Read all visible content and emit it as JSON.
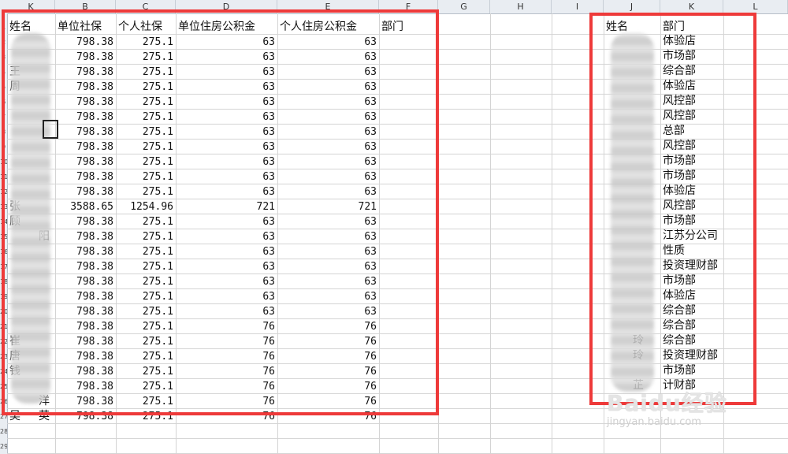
{
  "column_headers": [
    "K",
    "B",
    "C",
    "D",
    "E",
    "F",
    "G",
    "H",
    "I",
    "J",
    "K",
    "L"
  ],
  "row_numbers": [
    "1",
    "2",
    "3",
    "4",
    "5",
    "6",
    "7",
    "8",
    "9",
    "10",
    "11",
    "12",
    "13",
    "14",
    "15",
    "16",
    "17",
    "18",
    "19",
    "20",
    "21",
    "22",
    "23",
    "24",
    "25",
    "26",
    "27",
    "28",
    "29"
  ],
  "left_table": {
    "headers": [
      "姓名",
      "单位社保",
      "个人社保",
      "单位住房公积金",
      "个人住房公积金",
      "部门"
    ],
    "name_fragments": [
      "",
      "",
      "王",
      "周",
      "",
      "",
      "",
      "",
      "",
      "",
      "",
      "张",
      "顾",
      "",
      "",
      "",
      "",
      "",
      "",
      "",
      "崔",
      "唐",
      "钱",
      "",
      "",
      "吴"
    ],
    "name_suffixes": [
      "",
      "",
      "",
      "",
      "",
      "",
      "",
      "",
      "",
      "",
      "",
      "",
      "",
      "阳",
      "",
      "",
      "",
      "",
      "",
      "",
      "",
      "",
      "",
      "",
      "洋",
      "英"
    ],
    "rows": [
      [
        "798.38",
        "275.1",
        "63",
        "63"
      ],
      [
        "798.38",
        "275.1",
        "63",
        "63"
      ],
      [
        "798.38",
        "275.1",
        "63",
        "63"
      ],
      [
        "798.38",
        "275.1",
        "63",
        "63"
      ],
      [
        "798.38",
        "275.1",
        "63",
        "63"
      ],
      [
        "798.38",
        "275.1",
        "63",
        "63"
      ],
      [
        "798.38",
        "275.1",
        "63",
        "63"
      ],
      [
        "798.38",
        "275.1",
        "63",
        "63"
      ],
      [
        "798.38",
        "275.1",
        "63",
        "63"
      ],
      [
        "798.38",
        "275.1",
        "63",
        "63"
      ],
      [
        "798.38",
        "275.1",
        "63",
        "63"
      ],
      [
        "3588.65",
        "1254.96",
        "721",
        "721"
      ],
      [
        "798.38",
        "275.1",
        "63",
        "63"
      ],
      [
        "798.38",
        "275.1",
        "63",
        "63"
      ],
      [
        "798.38",
        "275.1",
        "63",
        "63"
      ],
      [
        "798.38",
        "275.1",
        "63",
        "63"
      ],
      [
        "798.38",
        "275.1",
        "63",
        "63"
      ],
      [
        "798.38",
        "275.1",
        "63",
        "63"
      ],
      [
        "798.38",
        "275.1",
        "63",
        "63"
      ],
      [
        "798.38",
        "275.1",
        "76",
        "76"
      ],
      [
        "798.38",
        "275.1",
        "76",
        "76"
      ],
      [
        "798.38",
        "275.1",
        "76",
        "76"
      ],
      [
        "798.38",
        "275.1",
        "76",
        "76"
      ],
      [
        "798.38",
        "275.1",
        "76",
        "76"
      ],
      [
        "798.38",
        "275.1",
        "76",
        "76"
      ],
      [
        "798.38",
        "275.1",
        "76",
        "76"
      ]
    ]
  },
  "right_table": {
    "headers": [
      "姓名",
      "部门"
    ],
    "name_fragments": [
      "",
      "",
      "",
      "",
      "",
      "",
      "",
      "",
      "",
      "",
      "",
      "",
      "",
      "",
      "",
      "",
      "",
      "",
      "",
      "",
      "玲",
      "玲",
      "",
      "芷",
      "",
      "",
      ""
    ],
    "departments": [
      "体验店",
      "市场部",
      "综合部",
      "体验店",
      "风控部",
      "风控部",
      "总部",
      "风控部",
      "市场部",
      "市场部",
      "体验店",
      "风控部",
      "市场部",
      "江苏分公司",
      "性质",
      "投资理财部",
      "市场部",
      "体验店",
      "综合部",
      "综合部",
      "综合部",
      "投资理财部",
      "市场部",
      "计财部"
    ]
  },
  "watermark": {
    "logo": "Baidu经验",
    "url": "jingyan.baidu.com"
  },
  "colors": {
    "highlight_border": "#ee3a3a",
    "grid_line": "#d4d4d4",
    "header_bg": "#e9edf2"
  }
}
